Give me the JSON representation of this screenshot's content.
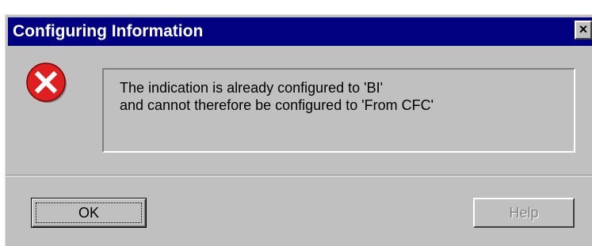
{
  "dialog": {
    "title": "Configuring Information",
    "close_glyph": "×",
    "icon": "error-icon",
    "message_lines": [
      "The indication is already configured to 'BI'",
      "and cannot therefore be configured to 'From CFC'"
    ],
    "buttons": {
      "ok_label": "OK",
      "help_label": "Help",
      "help_disabled": true
    }
  },
  "colors": {
    "titlebar": "#000080",
    "face": "#c0c0c0",
    "error_red": "#e02020"
  }
}
